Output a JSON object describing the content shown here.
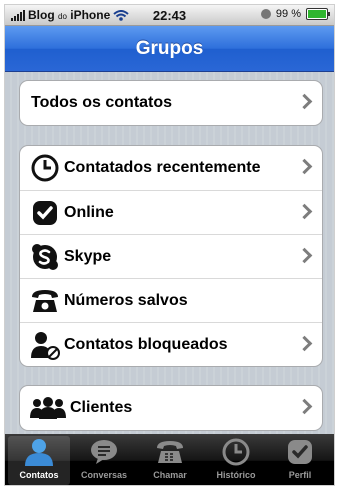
{
  "status_bar": {
    "carrier_main": "Blog",
    "carrier_small": "do",
    "carrier_end": "iPhone",
    "time": "22:43",
    "battery": "99 %",
    "battery_level": 0.99
  },
  "nav": {
    "title": "Grupos"
  },
  "groups": [
    {
      "rows": [
        {
          "label": "Todos os contatos",
          "icon": "none"
        }
      ]
    },
    {
      "rows": [
        {
          "label": "Contatados recentemente",
          "icon": "clock-icon"
        },
        {
          "label": "Online",
          "icon": "check-badge-icon"
        },
        {
          "label": "Skype",
          "icon": "skype-logo-icon"
        },
        {
          "label": "Números salvos",
          "icon": "phone-icon"
        },
        {
          "label": "Contatos bloqueados",
          "icon": "blocked-user-icon"
        }
      ]
    },
    {
      "rows": [
        {
          "label": "Clientes",
          "icon": "people-group-icon"
        }
      ]
    }
  ],
  "tab_bar": {
    "tabs": [
      {
        "label": "Contatos",
        "icon": "person-icon",
        "active": true
      },
      {
        "label": "Conversas",
        "icon": "chat-bubble-icon",
        "active": false
      },
      {
        "label": "Chamar",
        "icon": "phone-icon",
        "active": false
      },
      {
        "label": "Histórico",
        "icon": "clock-icon",
        "active": false
      },
      {
        "label": "Perfil",
        "icon": "check-badge-icon",
        "active": false
      }
    ]
  },
  "colors": {
    "nav_blue": "#2e6fdb",
    "group_bg": "#ffffff",
    "page_bg": "#c5ccd4",
    "active_tab": "#3b8bd6"
  }
}
